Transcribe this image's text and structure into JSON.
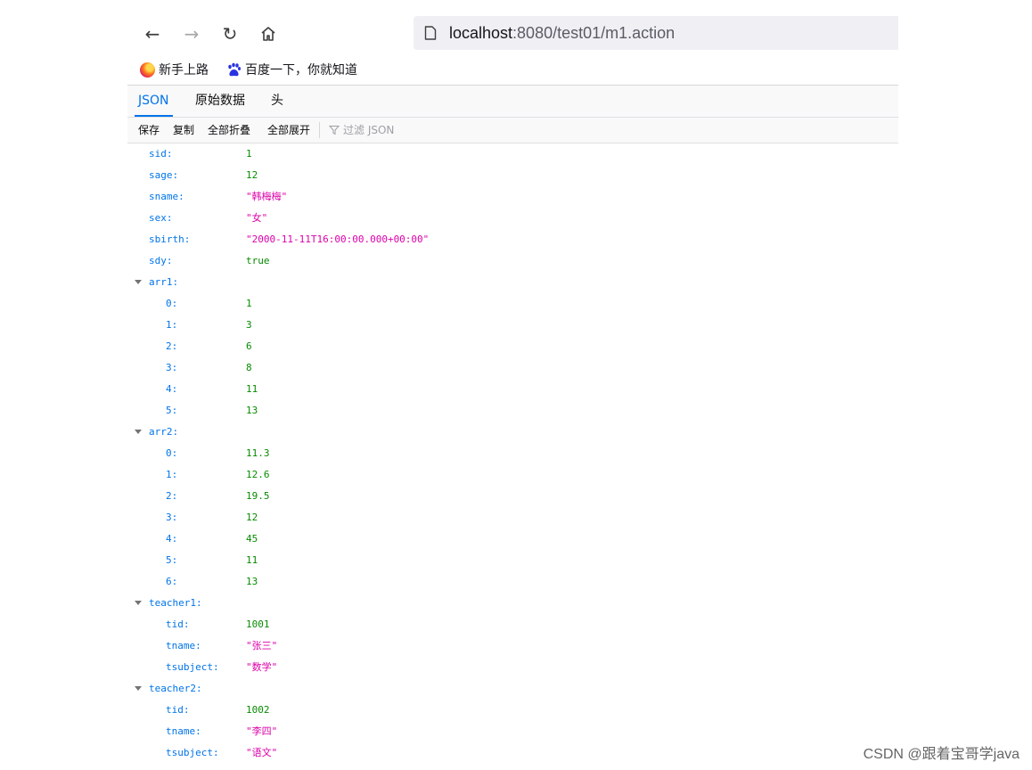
{
  "browser": {
    "url_host": "localhost",
    "url_path": ":8080/test01/m1.action",
    "bookmarks": [
      {
        "label": "新手上路",
        "icon": "firefox-icon"
      },
      {
        "label": "百度一下，你就知道",
        "icon": "baidu-paw-icon"
      }
    ]
  },
  "viewer": {
    "tabs": [
      {
        "label": "JSON",
        "active": true
      },
      {
        "label": "原始数据",
        "active": false
      },
      {
        "label": "头",
        "active": false
      }
    ],
    "toolbar": {
      "save": "保存",
      "copy": "复制",
      "collapse_all": "全部折叠",
      "expand_all": "全部展开",
      "filter_placeholder": "过滤 JSON"
    }
  },
  "json": {
    "sid": {
      "key": "sid:",
      "value": "1"
    },
    "sage": {
      "key": "sage:",
      "value": "12"
    },
    "sname": {
      "key": "sname:",
      "value": "\"韩梅梅\""
    },
    "sex": {
      "key": "sex:",
      "value": "\"女\""
    },
    "sbirth": {
      "key": "sbirth:",
      "value": "\"2000-11-11T16:00:00.000+00:00\""
    },
    "sdy": {
      "key": "sdy:",
      "value": "true"
    },
    "arr1": {
      "key": "arr1:",
      "items": [
        {
          "key": "0:",
          "value": "1"
        },
        {
          "key": "1:",
          "value": "3"
        },
        {
          "key": "2:",
          "value": "6"
        },
        {
          "key": "3:",
          "value": "8"
        },
        {
          "key": "4:",
          "value": "11"
        },
        {
          "key": "5:",
          "value": "13"
        }
      ]
    },
    "arr2": {
      "key": "arr2:",
      "items": [
        {
          "key": "0:",
          "value": "11.3"
        },
        {
          "key": "1:",
          "value": "12.6"
        },
        {
          "key": "2:",
          "value": "19.5"
        },
        {
          "key": "3:",
          "value": "12"
        },
        {
          "key": "4:",
          "value": "45"
        },
        {
          "key": "5:",
          "value": "11"
        },
        {
          "key": "6:",
          "value": "13"
        }
      ]
    },
    "teacher1": {
      "key": "teacher1:",
      "tid": {
        "key": "tid:",
        "value": "1001"
      },
      "tname": {
        "key": "tname:",
        "value": "\"张三\""
      },
      "tsubject": {
        "key": "tsubject:",
        "value": "\"数学\""
      }
    },
    "teacher2": {
      "key": "teacher2:",
      "tid": {
        "key": "tid:",
        "value": "1002"
      },
      "tname": {
        "key": "tname:",
        "value": "\"李四\""
      },
      "tsubject": {
        "key": "tsubject:",
        "value": "\"语文\""
      }
    }
  },
  "watermark": "CSDN @跟着宝哥学java"
}
